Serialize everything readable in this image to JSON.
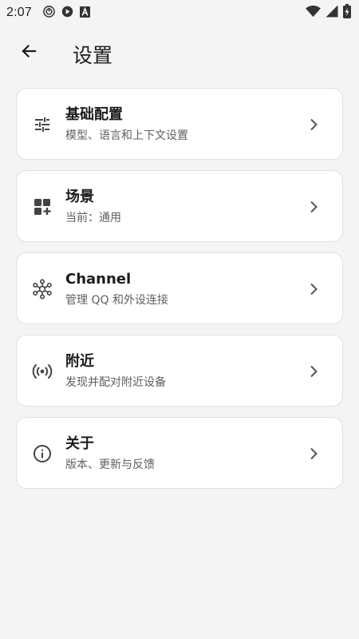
{
  "status_bar": {
    "time": "2:07",
    "notification_icons": [
      "vpn-key-icon",
      "play-icon",
      "font-a-icon"
    ],
    "system_icons": [
      "wifi-icon",
      "signal-icon",
      "battery-charging-icon"
    ]
  },
  "app_bar": {
    "back_icon": "arrow-left-icon",
    "title": "设置"
  },
  "settings": {
    "items": [
      {
        "icon": "tune-sliders-icon",
        "title": "基础配置",
        "subtitle": "模型、语言和上下文设置"
      },
      {
        "icon": "widgets-add-icon",
        "title": "场景",
        "subtitle": "当前：通用"
      },
      {
        "icon": "hub-network-icon",
        "title": "Channel",
        "subtitle": "管理 QQ 和外设连接"
      },
      {
        "icon": "broadcast-icon",
        "title": "附近",
        "subtitle": "发现并配对附近设备"
      },
      {
        "icon": "info-circle-icon",
        "title": "关于",
        "subtitle": "版本、更新与反馈"
      }
    ],
    "chevron_icon": "chevron-right-icon"
  },
  "colors": {
    "background": "#f4f4f4",
    "card": "#ffffff",
    "card_border": "#e0e0e0",
    "primary_text": "#1c1c1c",
    "secondary_text": "#5f5f5f",
    "icon": "#444444"
  }
}
